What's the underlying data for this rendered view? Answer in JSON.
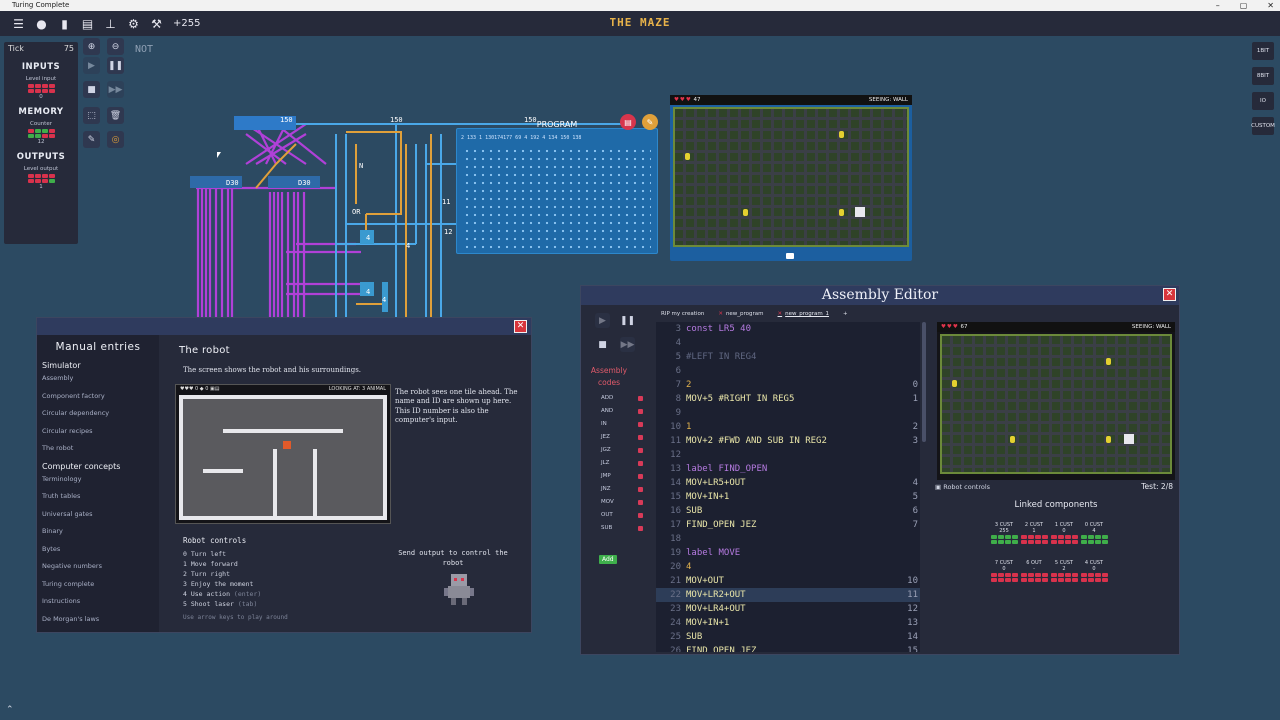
{
  "window": {
    "title": "Turing Complete",
    "controls": [
      "–",
      "▢",
      "✕"
    ]
  },
  "topbar": {
    "icons": [
      "menu-icon",
      "chat-icon",
      "document-icon",
      "notes-icon",
      "hierarchy-icon",
      "gear-icon",
      "wrench-icon"
    ],
    "count": "+255"
  },
  "level_title": "THE MAZE",
  "left_panel": {
    "tick_label": "Tick",
    "tick_value": "75",
    "inputs_title": "INPUTS",
    "inputs_sub": "Level input",
    "inputs_val": "0",
    "memory_title": "MEMORY",
    "memory_sub": "Counter",
    "memory_val": "12",
    "outputs_title": "OUTPUTS",
    "outputs_sub": "Level output",
    "outputs_val": "1"
  },
  "not_label": "NOT",
  "right_strip": [
    "1BIT",
    "8BIT",
    "IO",
    "CUSTOM"
  ],
  "circuit": {
    "program_title": "PROGRAM",
    "program_numbers": "2  133  1  130174177  69  4  192  4  134  150  138",
    "labels": [
      "150",
      "150",
      "150",
      "D30",
      "D30",
      "OR",
      "11",
      "12",
      "4",
      "4",
      "4",
      "4",
      "N"
    ]
  },
  "maze_top": {
    "hearts": "♥♥♥",
    "score": "47",
    "seeing": "SEEING: WALL"
  },
  "manual": {
    "sidebar_title": "Manual entries",
    "sections": [
      {
        "title": "Simulator",
        "items": [
          "Assembly",
          "Component factory",
          "Circular dependency",
          "Circular recipes",
          "The robot"
        ]
      },
      {
        "title": "Computer concepts",
        "items": [
          "Terminology",
          "Truth tables",
          "Universal gates",
          "Binary",
          "Bytes",
          "Negative numbers",
          "Turing complete",
          "Instructions",
          "De Morgan's laws"
        ]
      }
    ],
    "page_title": "The robot",
    "description": "The screen shows the robot and his surroundings.",
    "shot_hud_left": "♥♥♥ 0 ◆ 0 ▣▤",
    "shot_hud_right": "LOOKING AT: 3 ANIMAL",
    "note": "The robot sees one tile ahead. The name and ID are shown up here. This ID number is also the computer's input.",
    "controls_title": "Robot controls",
    "controls": [
      {
        "k": "0",
        "t": "Turn left",
        "x": ""
      },
      {
        "k": "1",
        "t": "Move forward",
        "x": ""
      },
      {
        "k": "2",
        "t": "Turn right",
        "x": ""
      },
      {
        "k": "3",
        "t": "Enjoy the moment",
        "x": ""
      },
      {
        "k": "4",
        "t": "Use action",
        "x": "(enter)"
      },
      {
        "k": "5",
        "t": "Shoot laser",
        "x": "(tab)"
      }
    ],
    "controls_hint": "Use arrow keys to play around",
    "send_output": "Send output to control the robot"
  },
  "asm": {
    "title": "Assembly Editor",
    "codes_label": "Assembly codes",
    "ops": [
      "ADD",
      "AND",
      "IN",
      "JEZ",
      "JGZ",
      "JLZ",
      "JMP",
      "JNZ",
      "MOV",
      "OUT",
      "SUB"
    ],
    "add_label": "Add",
    "tabs": [
      "RIP my creation",
      "new_program",
      "new_program_1"
    ],
    "tab_plus": "+",
    "code": [
      {
        "n": "3",
        "t": "const LR5 40",
        "a": "",
        "hl": false
      },
      {
        "n": "4",
        "t": "",
        "a": "",
        "hl": false
      },
      {
        "n": "5",
        "t": "#LEFT IN REG4",
        "a": "",
        "hl": false
      },
      {
        "n": "6",
        "t": "",
        "a": "",
        "hl": false
      },
      {
        "n": "7",
        "t": "2",
        "a": "0",
        "hl": false
      },
      {
        "n": "8",
        "t": "MOV+5 #RIGHT IN REG5",
        "a": "1",
        "hl": false
      },
      {
        "n": "9",
        "t": "",
        "a": "",
        "hl": false
      },
      {
        "n": "10",
        "t": "1",
        "a": "2",
        "hl": false
      },
      {
        "n": "11",
        "t": "MOV+2 #FWD AND SUB IN REG2",
        "a": "3",
        "hl": false
      },
      {
        "n": "12",
        "t": "",
        "a": "",
        "hl": false
      },
      {
        "n": "13",
        "t": "label FIND_OPEN",
        "a": "",
        "hl": false
      },
      {
        "n": "14",
        "t": "MOV+LR5+OUT",
        "a": "4",
        "hl": false
      },
      {
        "n": "15",
        "t": "MOV+IN+1",
        "a": "5",
        "hl": false
      },
      {
        "n": "16",
        "t": "SUB",
        "a": "6",
        "hl": false
      },
      {
        "n": "17",
        "t": "FIND_OPEN JEZ",
        "a": "7",
        "hl": false
      },
      {
        "n": "18",
        "t": "",
        "a": "",
        "hl": false
      },
      {
        "n": "19",
        "t": "label MOVE",
        "a": "",
        "hl": false
      },
      {
        "n": "20",
        "t": "4",
        "a": "",
        "hl": false
      },
      {
        "n": "21",
        "t": "MOV+OUT",
        "a": "10",
        "hl": false
      },
      {
        "n": "22",
        "t": "MOV+LR2+OUT",
        "a": "11",
        "hl": true
      },
      {
        "n": "23",
        "t": "MOV+LR4+OUT",
        "a": "12",
        "hl": false
      },
      {
        "n": "24",
        "t": "MOV+IN+1",
        "a": "13",
        "hl": false
      },
      {
        "n": "25",
        "t": "SUB",
        "a": "14",
        "hl": false
      },
      {
        "n": "26",
        "t": "FIND_OPEN JEZ",
        "a": "15",
        "hl": false
      }
    ],
    "maze": {
      "hearts": "♥♥♥",
      "score": "67",
      "seeing": "SEEING: WALL"
    },
    "robot_controls": "Robot controls",
    "test": "Test: 2/8",
    "linked_title": "Linked components",
    "custs": [
      {
        "label": "3 CUST",
        "val": "255",
        "green": true
      },
      {
        "label": "2 CUST",
        "val": "1",
        "green": false
      },
      {
        "label": "1 CUST",
        "val": "0",
        "green": false
      },
      {
        "label": "0 CUST",
        "val": "4",
        "green": true
      },
      {
        "label": "7 CUST",
        "val": "0",
        "green": false
      },
      {
        "label": "6 OUT",
        "val": "-",
        "green": false
      },
      {
        "label": "5 CUST",
        "val": "2",
        "green": false
      },
      {
        "label": "4 CUST",
        "val": "0",
        "green": false
      }
    ]
  },
  "colors": {
    "accent": "#e8b34a",
    "panel": "#262a3a",
    "background": "#2c4a62",
    "wire_purple": "#b040d8",
    "wire_blue": "#4aa8e8",
    "wire_orange": "#e0a03a",
    "close": "#d8353c"
  }
}
